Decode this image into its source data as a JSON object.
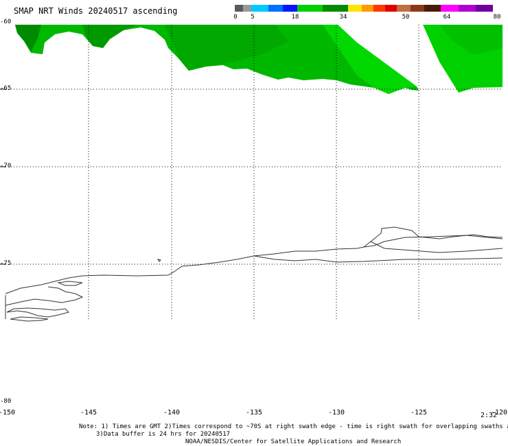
{
  "title": "SMAP NRT Winds 20240517 ascending",
  "legend": {
    "ticks": [
      "0",
      "5",
      "18",
      "34",
      "50",
      "64",
      "80"
    ],
    "colors": [
      "#5a5a5a",
      "#9a9a9a",
      "#00c8ff",
      "#0070ff",
      "#0018ff",
      "#00d000",
      "#008a00",
      "#ffe400",
      "#ff9a00",
      "#ff3800",
      "#e00000",
      "#c07040",
      "#8a3a1a",
      "#4a1a0a",
      "#ff00ff",
      "#b000d0",
      "#7000a0"
    ]
  },
  "map": {
    "lat_labels": [
      "-60",
      "-65",
      "-70",
      "-75",
      "-80"
    ],
    "lon_labels": [
      "-150",
      "-145",
      "-140",
      "-135",
      "-130",
      "-125",
      "-120"
    ],
    "timestamp": "2:32"
  },
  "notes": {
    "line1": "Note: 1) Times are GMT 2)Times correspond to ~70S at right swath edge - time is right swath for overlapping swaths at ~70S",
    "line2": "3)Data buffer is 24 hrs for 20240517",
    "line3": "NOAA/NESDIS/Center for Satellite Applications and Research"
  }
}
